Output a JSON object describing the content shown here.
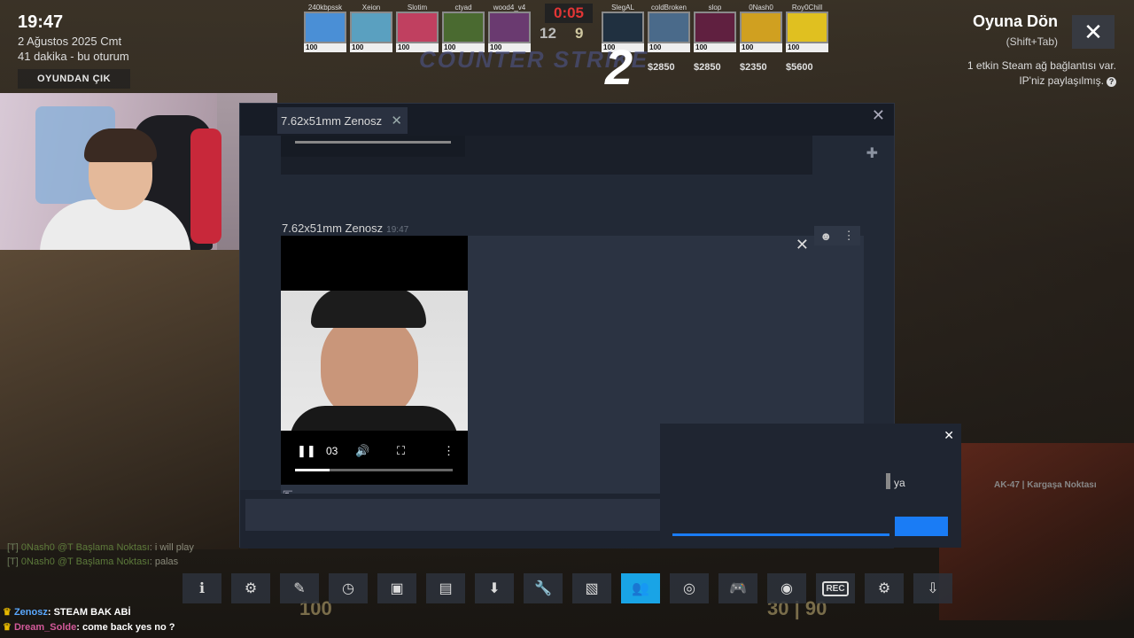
{
  "clock": {
    "time": "19:47",
    "date": "2 Ağustos 2025 Cmt",
    "session": "41 dakika - bu oturum",
    "exit_label": "OYUNDAN ÇIK"
  },
  "hud": {
    "timer": "0:05",
    "score_ct": "12",
    "score_t": "9",
    "logo": "COUNTER STRIKE",
    "logo_number": "2",
    "players_left": [
      {
        "name": "240kbpssk",
        "hp": "100",
        "color": "#4a8fd6"
      },
      {
        "name": "Xeion",
        "hp": "100",
        "color": "#5aa0c0"
      },
      {
        "name": "Slotim",
        "hp": "100",
        "color": "#c04060"
      },
      {
        "name": "ctyad",
        "hp": "100",
        "color": "#4a6a30"
      },
      {
        "name": "wood4_v4",
        "hp": "100",
        "color": "#6a3a70"
      }
    ],
    "players_right": [
      {
        "name": "SlegAL",
        "hp": "100",
        "money": "",
        "color": "#203040"
      },
      {
        "name": "coldBroken",
        "hp": "100",
        "money": "$2850",
        "color": "#4a6a8a"
      },
      {
        "name": "slop",
        "hp": "100",
        "money": "$2850",
        "color": "#602040"
      },
      {
        "name": "0Nash0",
        "hp": "100",
        "money": "$2350",
        "color": "#d0a020"
      },
      {
        "name": "Roy0Chill",
        "hp": "100",
        "money": "$5600",
        "color": "#e0c020"
      }
    ]
  },
  "overlay": {
    "return_title": "Oyuna Dön",
    "return_hint": "(Shift+Tab)",
    "network_line1": "1 etkin Steam ağ bağlantısı var.",
    "network_line2": "IP'niz paylaşılmış."
  },
  "chat_window": {
    "tab_title": "7.62x51mm Zenosz",
    "sender": "7.62x51mm Zenosz",
    "timestamp": "19:47",
    "video": {
      "time": "03",
      "progress": 0.22
    },
    "input_placeholder": ""
  },
  "popup2": {
    "text": "ya"
  },
  "weapon_label": "AK-47 | Kargaşa Noktası",
  "game_chat": [
    {
      "tag": "[T]",
      "name": "0Nash0 @T Başlama Noktası",
      "text": ": i will play"
    },
    {
      "tag": "[T]",
      "name": "0Nash0 @T Başlama Noktası",
      "text": ": palas"
    }
  ],
  "stream_chat": [
    {
      "user": "Zenosz",
      "msg": ": STEAM BAK ABİ"
    },
    {
      "user": "Dream_Solde",
      "msg": ": come back yes no ?"
    }
  ],
  "toolbar": [
    {
      "name": "info-icon",
      "glyph": "ℹ"
    },
    {
      "name": "achievements-icon",
      "glyph": "⚙"
    },
    {
      "name": "notes-icon",
      "glyph": "✎"
    },
    {
      "name": "timer-icon",
      "glyph": "◷"
    },
    {
      "name": "screenshots-icon",
      "glyph": "▣"
    },
    {
      "name": "chat-icon",
      "glyph": "▤"
    },
    {
      "name": "downloads-icon",
      "glyph": "⬇"
    },
    {
      "name": "tools-icon",
      "glyph": "🔧"
    },
    {
      "name": "media-icon",
      "glyph": "▧"
    },
    {
      "name": "friends-icon",
      "glyph": "👥",
      "active": true
    },
    {
      "name": "view-icon",
      "glyph": "◎"
    },
    {
      "name": "controller-icon",
      "glyph": "🎮",
      "dim": true
    },
    {
      "name": "web-icon",
      "glyph": "◉"
    },
    {
      "name": "record-icon",
      "glyph": "REC"
    },
    {
      "name": "settings-icon",
      "glyph": "⚙"
    },
    {
      "name": "minimize-icon",
      "glyph": "⇩"
    }
  ],
  "hud_bottom": {
    "hp": "100",
    "ammo": "30",
    "reserve": "90"
  }
}
